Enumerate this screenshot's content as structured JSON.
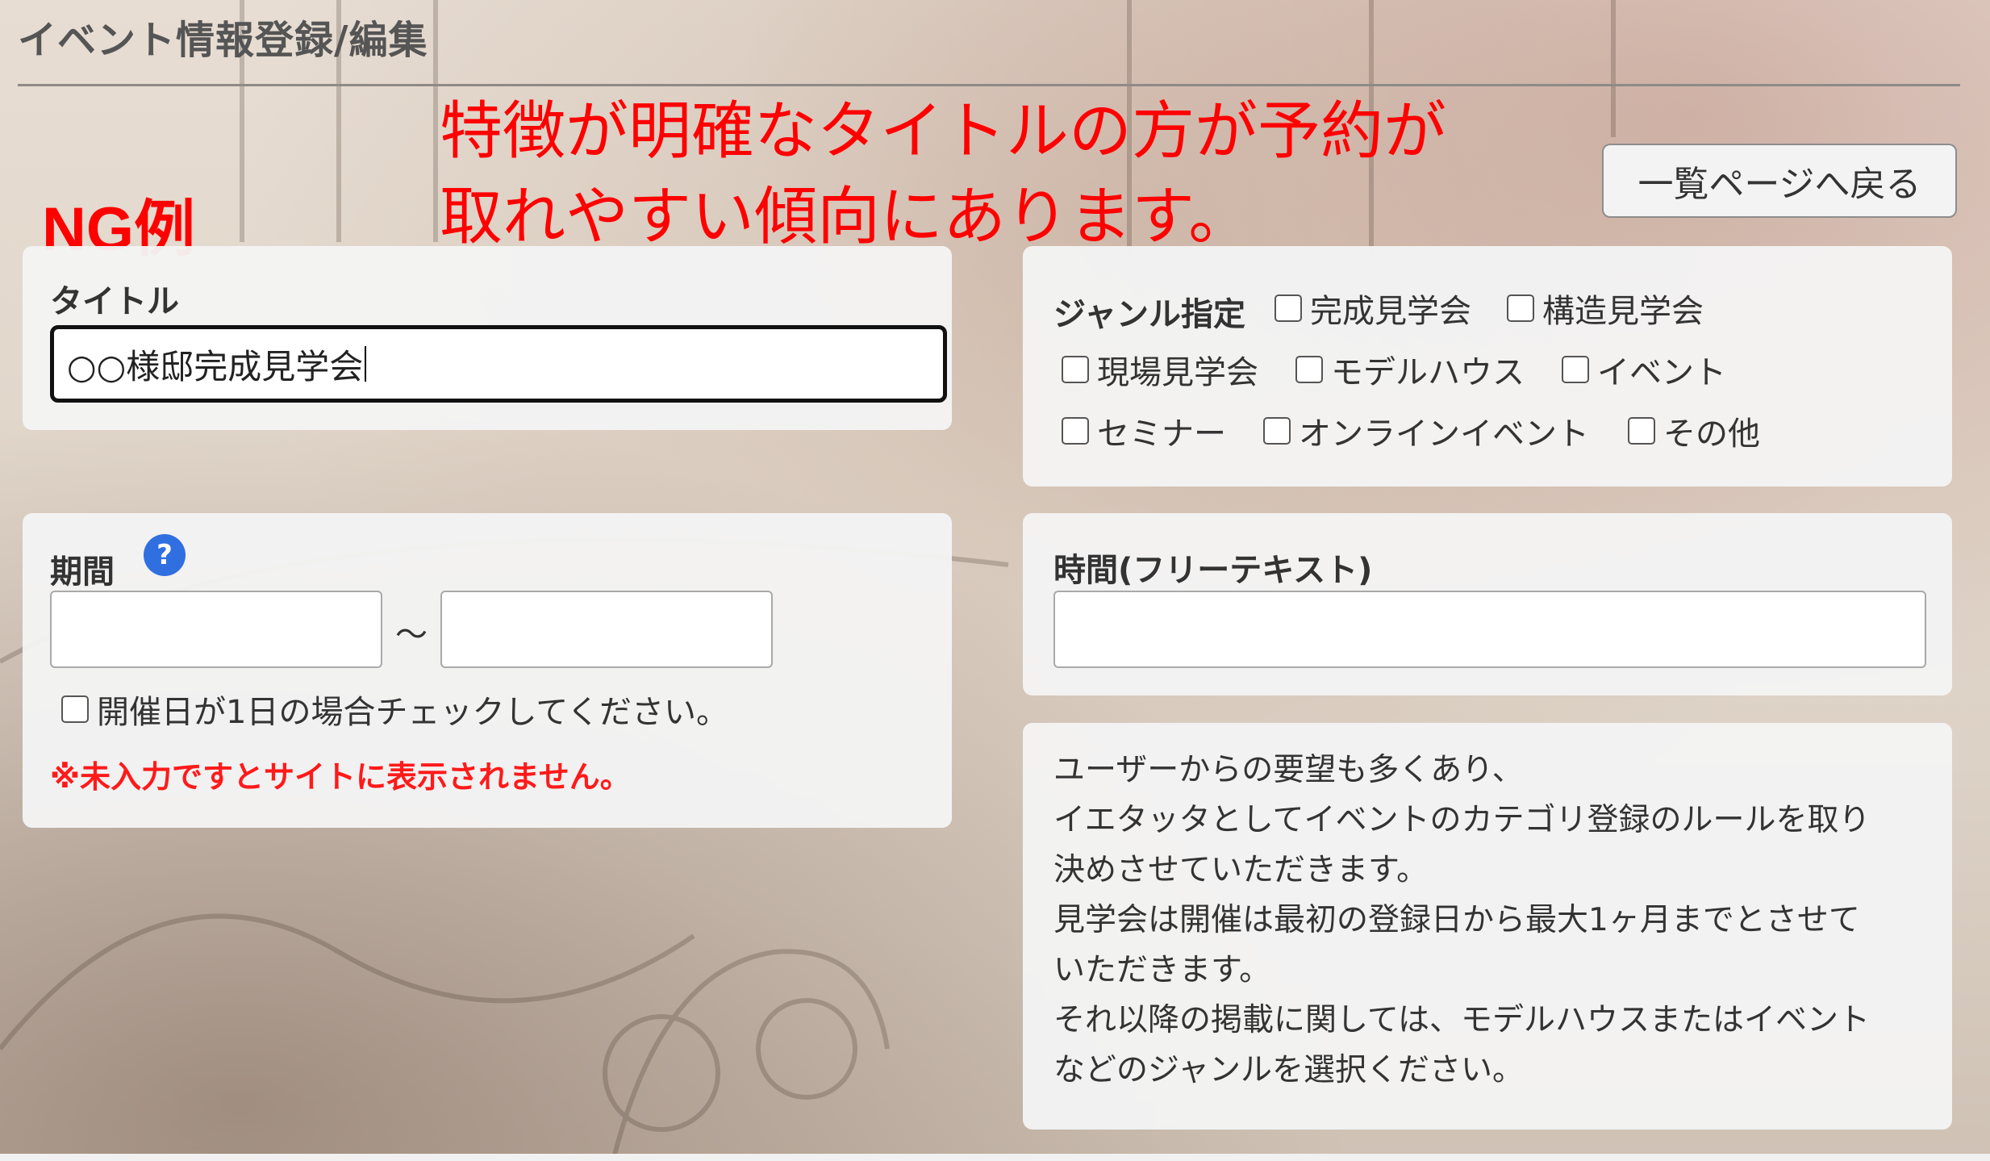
{
  "header": {
    "title": "イベント情報登録/編集"
  },
  "annotation": {
    "line1": "特徴が明確なタイトルの方が予約が",
    "line2": "取れやすい傾向にあります。",
    "ng_label": "NG例"
  },
  "back_button": {
    "label": "一覧ページへ戻る"
  },
  "title_field": {
    "label": "タイトル",
    "value": "○○様邸完成見学会"
  },
  "genre": {
    "label": "ジャンル指定",
    "options": [
      "完成見学会",
      "構造見学会",
      "現場見学会",
      "モデルハウス",
      "イベント",
      "セミナー",
      "オンラインイベント",
      "その他"
    ]
  },
  "period": {
    "label": "期間",
    "help_icon": "?",
    "start_value": "",
    "end_value": "",
    "separator": "～",
    "single_day_label": "開催日が1日の場合チェックしてください。",
    "warning": "※未入力ですとサイトに表示されません。"
  },
  "time_field": {
    "label": "時間(フリーテキスト)",
    "value": ""
  },
  "note": {
    "lines": [
      "ユーザーからの要望も多くあり、",
      "イエタッタとしてイベントのカテゴリ登録のルールを取り",
      "決めさせていただきます。",
      "見学会は開催は最初の登録日から最大1ヶ月までとさせて",
      "いただきます。",
      "それ以降の掲載に関しては、モデルハウスまたはイベント",
      "などのジャンルを選択ください。"
    ]
  }
}
